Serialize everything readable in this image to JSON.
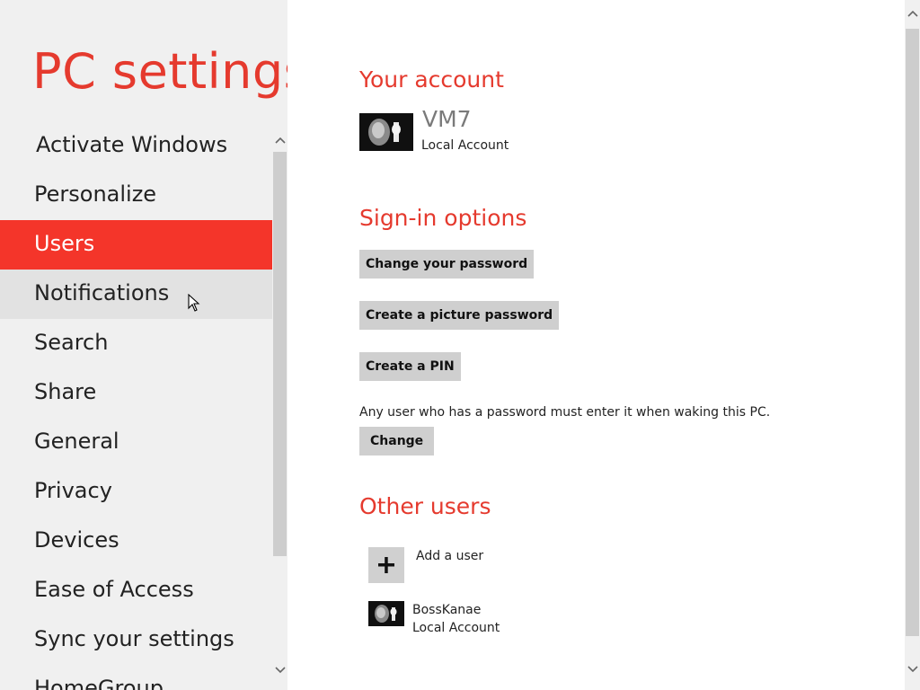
{
  "app_title": "PC settings",
  "nav": {
    "items": [
      {
        "label": "Activate Windows"
      },
      {
        "label": "Personalize"
      },
      {
        "label": "Users"
      },
      {
        "label": "Notifications"
      },
      {
        "label": "Search"
      },
      {
        "label": "Share"
      },
      {
        "label": "General"
      },
      {
        "label": "Privacy"
      },
      {
        "label": "Devices"
      },
      {
        "label": "Ease of Access"
      },
      {
        "label": "Sync your settings"
      },
      {
        "label": "HomeGroup"
      }
    ],
    "selected": "Users",
    "hovered": "Notifications"
  },
  "your_account": {
    "title": "Your account",
    "name": "VM7",
    "type": "Local Account"
  },
  "signin": {
    "title": "Sign-in options",
    "change_password": "Change your password",
    "picture_password": "Create a picture password",
    "create_pin": "Create a PIN",
    "note": "Any user who has a password must enter it when waking this PC.",
    "change": "Change"
  },
  "other_users": {
    "title": "Other users",
    "add_user": "Add a user",
    "users": [
      {
        "name": "BossKanae",
        "type": "Local Account"
      }
    ]
  },
  "colors": {
    "accent": "#e53a2e",
    "selected_bg": "#f4352a",
    "pane_bg": "#f0f0f0",
    "button_bg": "#cfcfcf"
  },
  "icons": [
    "chevron-up-icon",
    "chevron-down-icon",
    "plus-icon",
    "mouse-cursor-icon"
  ]
}
